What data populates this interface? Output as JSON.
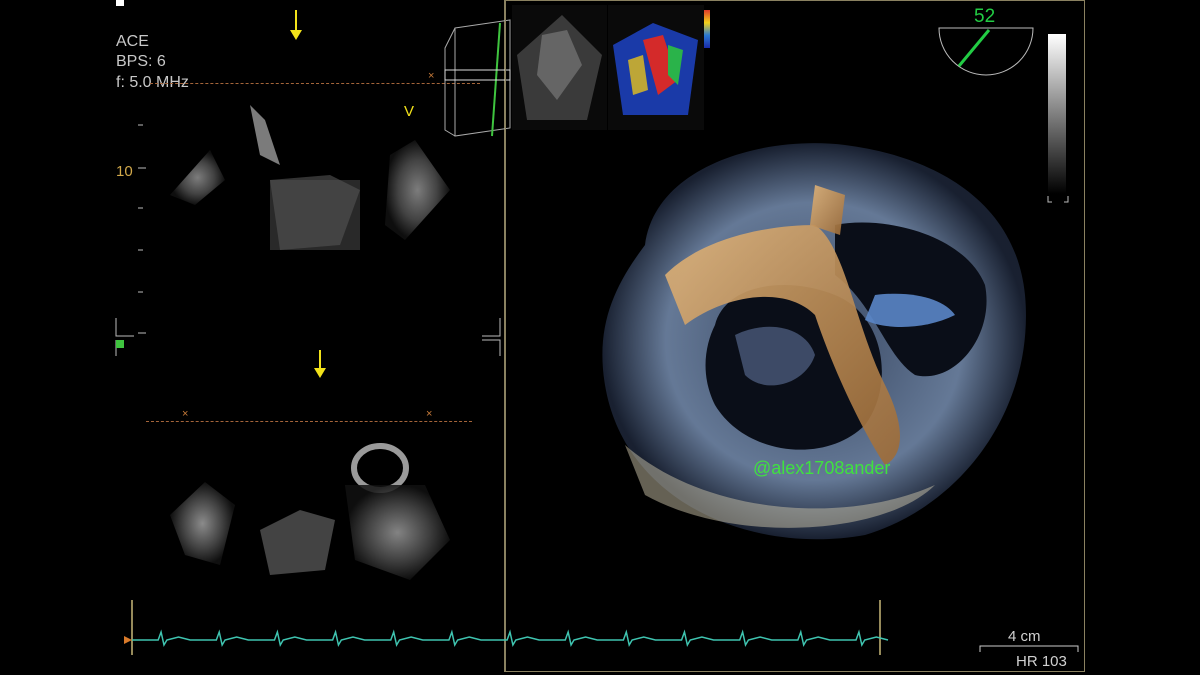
{
  "settings": {
    "preset": "ACE",
    "bps": "BPS:  6",
    "freq": "f: 5.0 MHz",
    "depth_mark": "10",
    "view_marker": "V"
  },
  "angle": {
    "value": "52",
    "degrees": 52
  },
  "watermark": "@alex1708ander",
  "scale": {
    "label": "4 cm"
  },
  "heart_rate": "HR 103",
  "colors": {
    "accent_yellow": "#f2e21a",
    "ecg": "#3fc4b0",
    "watermark": "#3fe23f",
    "angle_green": "#22cc44",
    "frame": "#8a8160"
  }
}
